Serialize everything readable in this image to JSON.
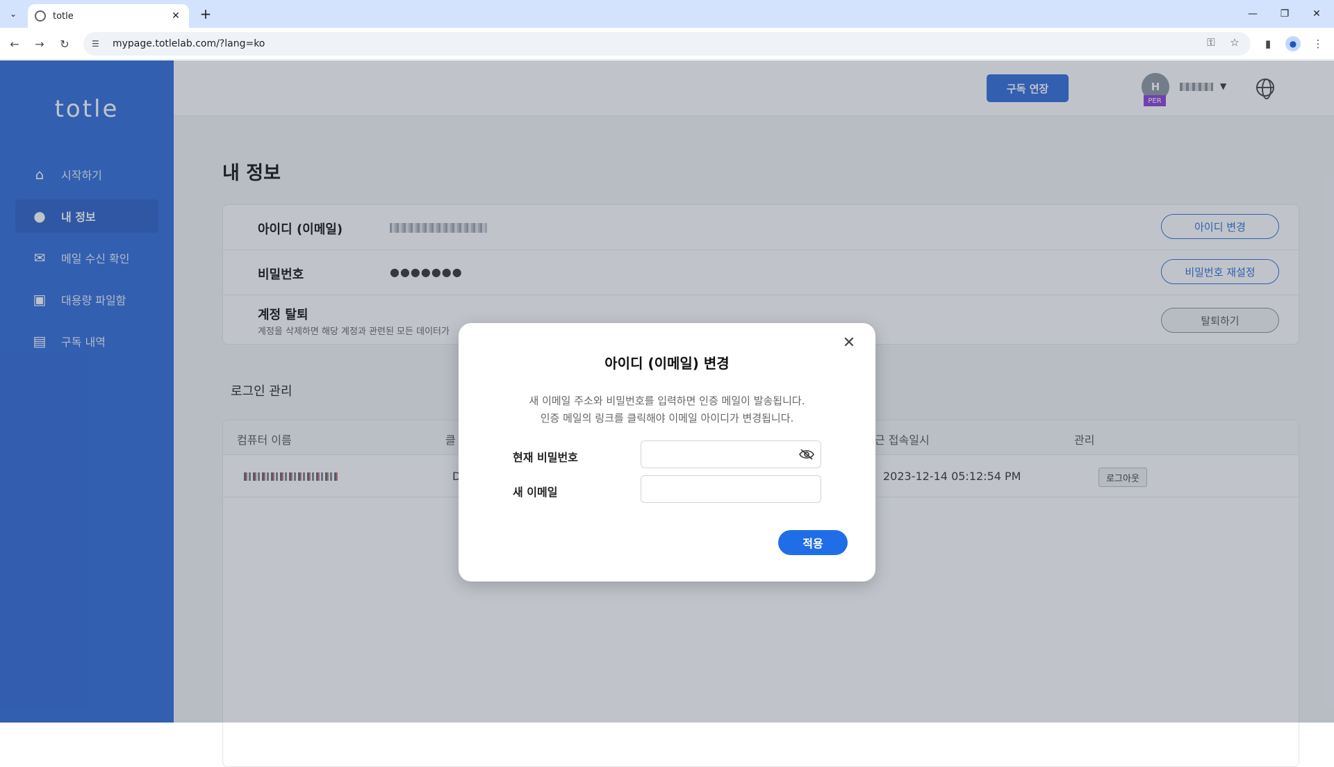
{
  "browser": {
    "tab_title": "totle",
    "url": "mypage.totlelab.com/?lang=ko"
  },
  "sidebar": {
    "logo": "totle",
    "items": [
      {
        "label": "시작하기",
        "icon": "home-icon"
      },
      {
        "label": "내 정보",
        "icon": "user-icon",
        "active": true
      },
      {
        "label": "메일 수신 확인",
        "icon": "mail-open-icon"
      },
      {
        "label": "대용량 파일함",
        "icon": "briefcase-icon"
      },
      {
        "label": "구독 내역",
        "icon": "receipt-icon"
      }
    ]
  },
  "header": {
    "renew_label": "구독 연장",
    "avatar_initial": "H",
    "plan_badge": "PER"
  },
  "page": {
    "title": "내 정보",
    "rows": {
      "id_label": "아이디 (이메일)",
      "id_button": "아이디 변경",
      "pw_label": "비밀번호",
      "pw_value": "●●●●●●●",
      "pw_button": "비밀번호 재설정",
      "withdraw_label": "계정 탈퇴",
      "withdraw_desc": "계정을 삭제하면 해당 계정과 관련된 모든 데이터가",
      "withdraw_button": "탈퇴하기"
    },
    "login_section": {
      "title": "로그인 관리",
      "columns": [
        "컴퓨터 이름",
        "클",
        "근 접속일시",
        "관리"
      ],
      "rows": [
        {
          "client": "D",
          "last_access": "2023-12-14 05:12:54 PM",
          "action": "로그아웃"
        }
      ]
    }
  },
  "modal": {
    "title": "아이디 (이메일) 변경",
    "desc_line1": "새 이메일 주소와 비밀번호를 입력하면 인증 메일이 발송됩니다.",
    "desc_line2": "인증 메일의 링크를 클릭해야 이메일 아이디가 변경됩니다.",
    "current_pw_label": "현재 비밀번호",
    "current_pw_value": "",
    "new_email_label": "새 이메일",
    "new_email_value": "",
    "apply_label": "적용"
  },
  "colors": {
    "sidebar": "#2f6ad9",
    "primary": "#1f6ee8",
    "badge": "#8a3fd6"
  }
}
